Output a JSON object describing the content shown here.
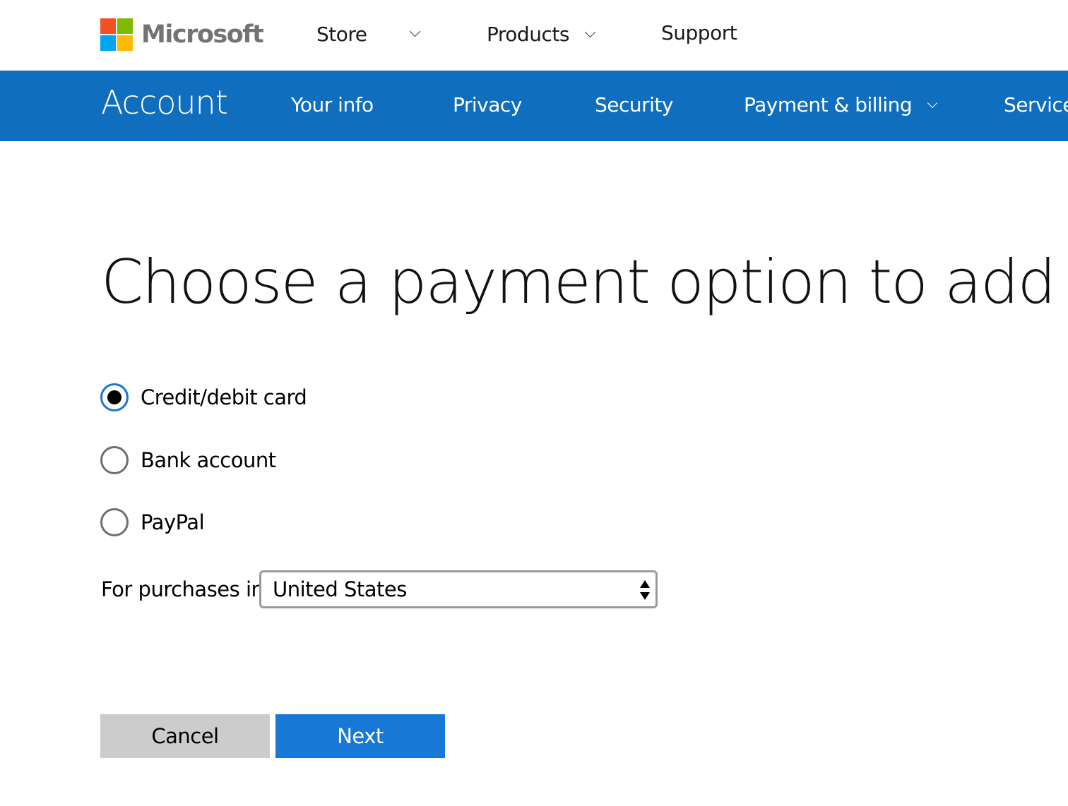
{
  "header": {
    "brand": "Microsoft",
    "logo_colors": [
      "#f25022",
      "#7fba00",
      "#00a4ef",
      "#ffb900"
    ],
    "nav": [
      {
        "label": "Store",
        "has_dropdown": true
      },
      {
        "label": "Products",
        "has_dropdown": true
      },
      {
        "label": "Support",
        "has_dropdown": false
      }
    ]
  },
  "account_nav": {
    "title": "Account",
    "background": "#106ebe",
    "items": [
      {
        "label": "Your info",
        "has_dropdown": false
      },
      {
        "label": "Privacy",
        "has_dropdown": false
      },
      {
        "label": "Security",
        "has_dropdown": false
      },
      {
        "label": "Payment & billing",
        "has_dropdown": true
      },
      {
        "label": "Service",
        "has_dropdown": false
      }
    ]
  },
  "main": {
    "heading": "Choose a payment option to add",
    "payment_options": [
      {
        "label": "Credit/debit card",
        "selected": true
      },
      {
        "label": "Bank account",
        "selected": false
      },
      {
        "label": "PayPal",
        "selected": false
      }
    ],
    "country_label": "For purchases in",
    "country_value": "United States",
    "cancel_label": "Cancel",
    "next_label": "Next",
    "accent_color": "#1779d5"
  }
}
